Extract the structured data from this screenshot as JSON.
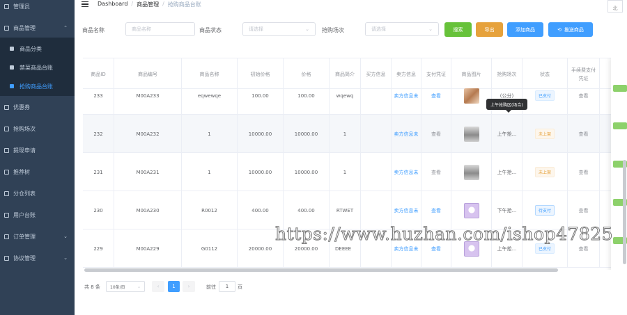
{
  "sidebar": {
    "items": [
      {
        "label": "管理员"
      },
      {
        "label": "商品管理"
      },
      {
        "label": "商品分类"
      },
      {
        "label": "禁菜商品台账"
      },
      {
        "label": "抢购商品台账"
      },
      {
        "label": "优惠券"
      },
      {
        "label": "抢购场次"
      },
      {
        "label": "提现申请"
      },
      {
        "label": "推荐树"
      },
      {
        "label": "分仓列表"
      },
      {
        "label": "用户台账"
      },
      {
        "label": "订单管理"
      },
      {
        "label": "协议管理"
      }
    ]
  },
  "header": {
    "breadcrumb": [
      "Dashboard",
      "商品管理",
      "抢购商品台账"
    ],
    "avatar_alt": "北"
  },
  "filters": {
    "name_label": "商品名称",
    "name_placeholder": "商品名称",
    "status_label": "商品状态",
    "status_placeholder": "请选择",
    "session_label": "抢购场次",
    "session_placeholder": "请选择",
    "search_btn": "搜索",
    "export_btn": "导出",
    "add_btn": "添加商品",
    "push_btn": "推送商品"
  },
  "colors": {
    "search": "#67c23a",
    "export": "#e6a23c",
    "primary": "#409eff"
  },
  "table": {
    "headers": [
      "商品ID",
      "商品编号",
      "商品名称",
      "初始价格",
      "价格",
      "商品简介",
      "买方信息",
      "卖方信息",
      "支付凭证",
      "商品图片",
      "抢购场次",
      "状态",
      "手续费支付凭证"
    ],
    "rows": [
      {
        "id": "233",
        "code": "M00A233",
        "name": "eqwewqe",
        "init_price": "100.00",
        "price": "100.00",
        "intro": "wqewq",
        "buyer": "",
        "seller": "卖方信息未",
        "proof": "查看",
        "image": "food",
        "session": "(公分)",
        "status": "已支付",
        "status_type": "paid",
        "fee_proof": "查看"
      },
      {
        "id": "232",
        "code": "M00A232",
        "name": "1",
        "init_price": "10000.00",
        "price": "10000.00",
        "intro": "1",
        "buyer": "",
        "seller": "卖方信息未",
        "proof": "查看",
        "image": "box",
        "session": "上午抢...",
        "status": "未上架",
        "status_type": "unpaid",
        "fee_proof": "查看"
      },
      {
        "id": "231",
        "code": "M00A231",
        "name": "1",
        "init_price": "10000.00",
        "price": "10000.00",
        "intro": "1",
        "buyer": "",
        "seller": "卖方信息未",
        "proof": "查看",
        "image": "box",
        "session": "上午抢...",
        "status": "未上架",
        "status_type": "unpaid",
        "fee_proof": "查看"
      },
      {
        "id": "230",
        "code": "M00A230",
        "name": "R0012",
        "init_price": "400.00",
        "price": "400.00",
        "intro": "RTWET",
        "buyer": "",
        "seller": "卖方信息未",
        "proof": "查看",
        "image": "cartoon",
        "session": "下午抢...",
        "status": "待支付",
        "status_type": "pending",
        "fee_proof": "查看"
      },
      {
        "id": "229",
        "code": "M00A229",
        "name": "G0112",
        "init_price": "20000.00",
        "price": "20000.00",
        "intro": "DEEEE",
        "buyer": "",
        "seller": "卖方信息未",
        "proof": "查看",
        "image": "cartoon",
        "session": "上午抢...",
        "status": "已支付",
        "status_type": "paid",
        "fee_proof": "查看"
      }
    ],
    "tooltip": "上午抢购区(场合)"
  },
  "pagination": {
    "total": "共 8 条",
    "page_size": "10条/页",
    "prev": "‹",
    "current": "1",
    "next": "›",
    "goto_label": "前往",
    "goto_value": "1",
    "page_suffix": "页"
  },
  "watermark": "https://www.huzhan.com/ishop47825"
}
